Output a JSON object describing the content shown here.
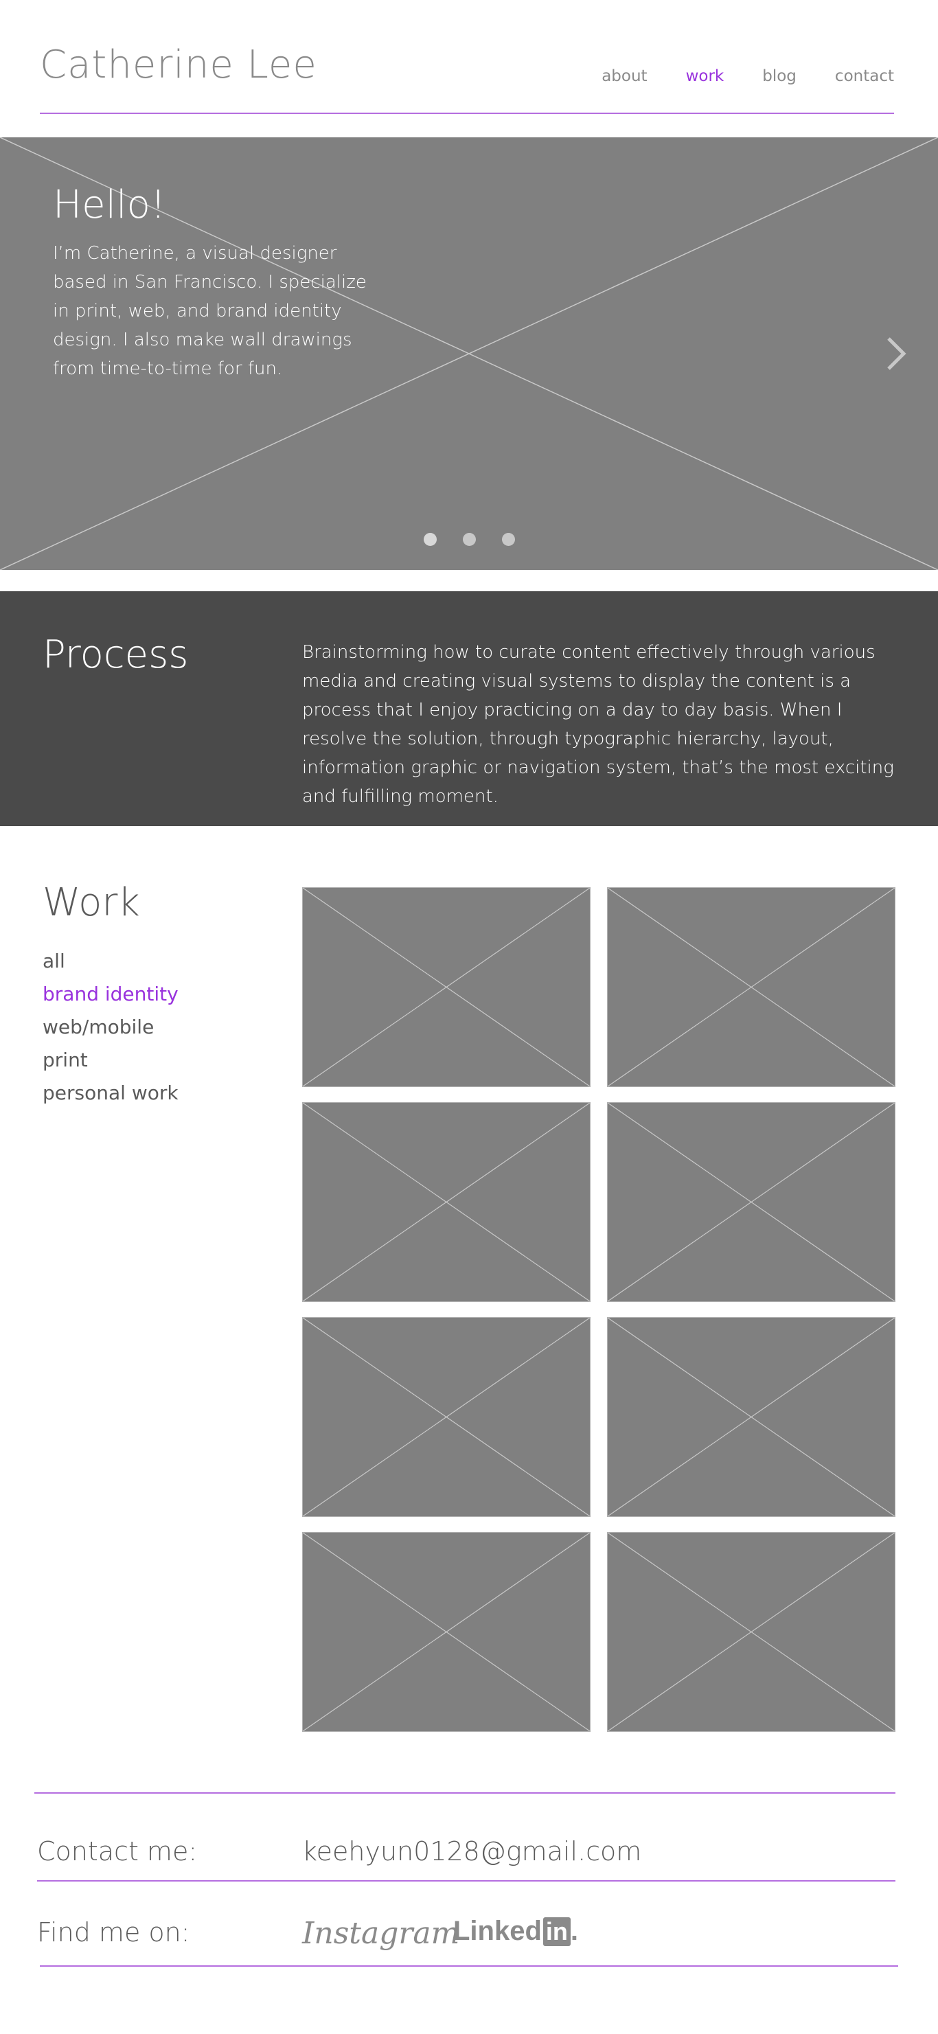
{
  "header": {
    "logo": "Catherine Lee",
    "nav": [
      {
        "label": "about"
      },
      {
        "label": "work"
      },
      {
        "label": "blog"
      },
      {
        "label": "contact"
      }
    ],
    "active_nav": "work",
    "accent_color": "#9933dd"
  },
  "hero": {
    "title": "Hello!",
    "text": "I’m Catherine, a visual designer based in San Francisco. I specialize in print, web, and brand identity design. I also make wall drawings from time-to-time for fun.",
    "next_icon": "chevron-right-icon",
    "slide_count": 3,
    "active_slide": 1
  },
  "process": {
    "title": "Process",
    "text": "Brainstorming how to curate content effectively through various media and creating visual systems to display the content is a process that I enjoy practicing on a day to day basis. When I resolve the solution, through typographic hierarchy, layout, information graphic or navigation system, that’s the most exciting and fulfilling moment."
  },
  "work": {
    "title": "Work",
    "filters": [
      {
        "label": "all"
      },
      {
        "label": "brand identity"
      },
      {
        "label": "web/mobile"
      },
      {
        "label": "print"
      },
      {
        "label": "personal work"
      }
    ],
    "active_filter": "brand identity",
    "thumbnail_count": 8
  },
  "contact": {
    "contact_label": "Contact me:",
    "email": "keehyun0128@gmail.com",
    "find_label": "Find me on:",
    "instagram": "Instagram",
    "linkedin_text": "Linked",
    "linkedin_box": "in",
    "linkedin_dot": "."
  }
}
